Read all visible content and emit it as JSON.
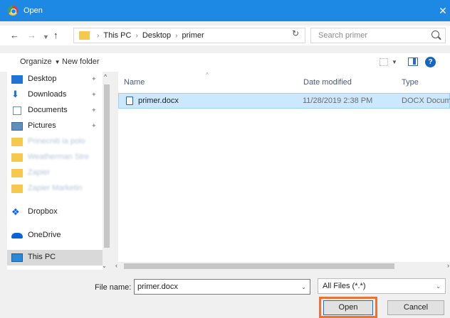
{
  "window": {
    "title": "Open",
    "close_glyph": "✕"
  },
  "address": {
    "path": [
      "This PC",
      "Desktop",
      "primer"
    ],
    "search_placeholder": "Search primer"
  },
  "toolbar": {
    "organize_label": "Organize",
    "new_folder_label": "New folder"
  },
  "nav": {
    "items": [
      {
        "label": "Desktop",
        "icon": "desktop-icon",
        "pinned": true
      },
      {
        "label": "Downloads",
        "icon": "download-icon",
        "pinned": true
      },
      {
        "label": "Documents",
        "icon": "documents-icon",
        "pinned": true
      },
      {
        "label": "Pictures",
        "icon": "pictures-icon",
        "pinned": true
      },
      {
        "label": "Prinecniti ia polo",
        "icon": "folder-icon",
        "blurred": true
      },
      {
        "label": "Weatherman Stre",
        "icon": "folder-icon",
        "blurred": true
      },
      {
        "label": "Zapier",
        "icon": "folder-icon",
        "blurred": true
      },
      {
        "label": "Zapier Marketin",
        "icon": "folder-icon",
        "blurred": true
      },
      {
        "label": "Dropbox",
        "icon": "dropbox-icon"
      },
      {
        "label": "OneDrive",
        "icon": "onedrive-icon"
      },
      {
        "label": "This PC",
        "icon": "computer-icon",
        "selected": true
      }
    ]
  },
  "files": {
    "columns": {
      "name": "Name",
      "date": "Date modified",
      "type": "Type"
    },
    "rows": [
      {
        "name": "primer.docx",
        "date": "11/28/2019 2:38 PM",
        "type": "DOCX Document",
        "selected": true
      }
    ]
  },
  "footer": {
    "file_name_label": "File name:",
    "file_name_value": "primer.docx",
    "filter_value": "All Files (*.*)",
    "open_label": "Open",
    "cancel_label": "Cancel"
  },
  "colors": {
    "titlebar": "#1e88e5",
    "selection": "#cce8ff",
    "highlight_ring": "#e8743b"
  }
}
